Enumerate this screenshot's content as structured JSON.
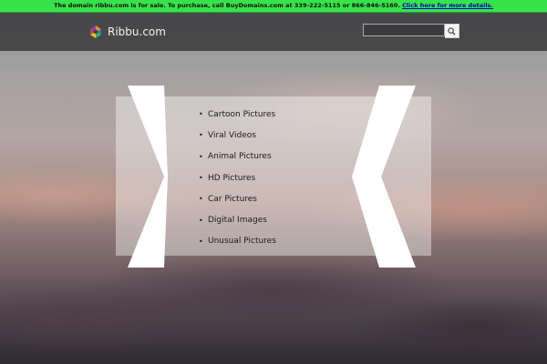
{
  "sale_banner": {
    "text": "The domain ribbu.com is for sale. To purchase, call BuyDomains.com at 339-222-5115 or 866-846-5160.",
    "link": "Click here for more details."
  },
  "header": {
    "logo_text": "Ribbu.com",
    "search": {
      "placeholder": "",
      "button_icon": "search-icon"
    }
  },
  "links": [
    {
      "label": "Cartoon Pictures"
    },
    {
      "label": "Viral Videos"
    },
    {
      "label": "Animal Pictures"
    },
    {
      "label": "HD Pictures"
    },
    {
      "label": "Car Pictures"
    },
    {
      "label": "Digital Images"
    },
    {
      "label": "Unusual Pictures"
    }
  ],
  "colors": {
    "banner_bg": "#38e24a",
    "banner_link": "#0000cc",
    "header_bg": "#3c3c3e",
    "chevron": "#ffffff"
  }
}
